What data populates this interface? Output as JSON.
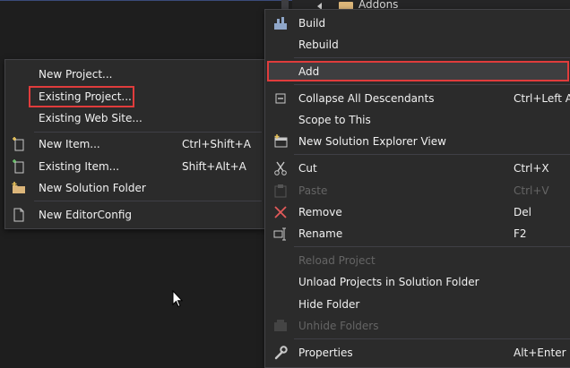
{
  "background": {
    "tree_item_label": "Addons"
  },
  "context_menu": {
    "items": [
      {
        "label": "Build",
        "shortcut": "",
        "icon": "build-icon",
        "disabled": false
      },
      {
        "label": "Rebuild",
        "shortcut": "",
        "icon": "",
        "disabled": false
      },
      {
        "label": "Add",
        "shortcut": "",
        "icon": "",
        "disabled": false,
        "highlighted": true
      },
      {
        "label": "Collapse All Descendants",
        "shortcut": "Ctrl+Left A",
        "icon": "collapse-icon",
        "disabled": false
      },
      {
        "label": "Scope to This",
        "shortcut": "",
        "icon": "",
        "disabled": false
      },
      {
        "label": "New Solution Explorer View",
        "shortcut": "",
        "icon": "new-view-icon",
        "disabled": false
      },
      {
        "label": "Cut",
        "shortcut": "Ctrl+X",
        "icon": "scissors-icon",
        "disabled": false
      },
      {
        "label": "Paste",
        "shortcut": "Ctrl+V",
        "icon": "clipboard-icon",
        "disabled": true
      },
      {
        "label": "Remove",
        "shortcut": "Del",
        "icon": "remove-icon",
        "disabled": false
      },
      {
        "label": "Rename",
        "shortcut": "F2",
        "icon": "rename-icon",
        "disabled": false
      },
      {
        "label": "Reload Project",
        "shortcut": "",
        "icon": "",
        "disabled": true
      },
      {
        "label": "Unload Projects in Solution Folder",
        "shortcut": "",
        "icon": "",
        "disabled": false
      },
      {
        "label": "Hide Folder",
        "shortcut": "",
        "icon": "",
        "disabled": false
      },
      {
        "label": "Unhide Folders",
        "shortcut": "",
        "icon": "unhide-icon",
        "disabled": true
      },
      {
        "label": "Properties",
        "shortcut": "Alt+Enter",
        "icon": "wrench-icon",
        "disabled": false
      }
    ]
  },
  "add_submenu": {
    "items": [
      {
        "label": "New Project...",
        "shortcut": "",
        "icon": ""
      },
      {
        "label": "Existing Project...",
        "shortcut": "",
        "icon": "",
        "highlighted": true
      },
      {
        "label": "Existing Web Site...",
        "shortcut": "",
        "icon": ""
      },
      {
        "label": "New Item...",
        "shortcut": "Ctrl+Shift+A",
        "icon": "new-item-icon"
      },
      {
        "label": "Existing Item...",
        "shortcut": "Shift+Alt+A",
        "icon": "existing-item-icon"
      },
      {
        "label": "New Solution Folder",
        "shortcut": "",
        "icon": "solution-folder-icon"
      },
      {
        "label": "New EditorConfig",
        "shortcut": "",
        "icon": "file-icon"
      }
    ]
  },
  "colors": {
    "menu_background": "#2b2b2b",
    "highlight_border": "#e03c3c",
    "disabled_text": "#656565",
    "folder": "#dcb67a"
  }
}
